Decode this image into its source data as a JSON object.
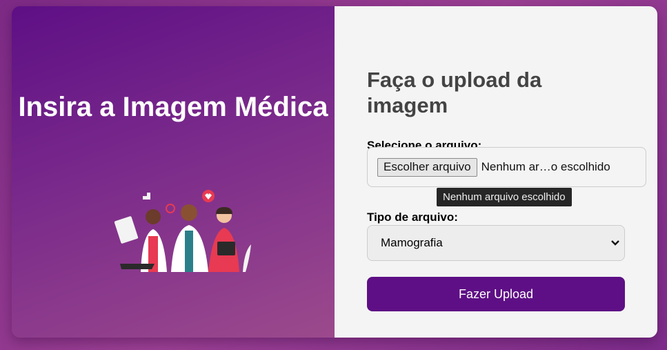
{
  "left": {
    "title": "Insira a Imagem Médica",
    "illustration_icon": "medical-team-illustration"
  },
  "right": {
    "title": "Faça o upload da imagem",
    "file_label": "Selecione o arquivo:",
    "file_button": "Escolher arquivo",
    "file_status": "Nenhum ar…o escolhido",
    "tooltip": "Nenhum arquivo escolhido",
    "type_label": "Tipo de arquivo:",
    "type_selected": "Mamografia",
    "upload_button": "Fazer Upload"
  },
  "colors": {
    "accent": "#5e0f85",
    "panel": "#f4f4f4"
  }
}
